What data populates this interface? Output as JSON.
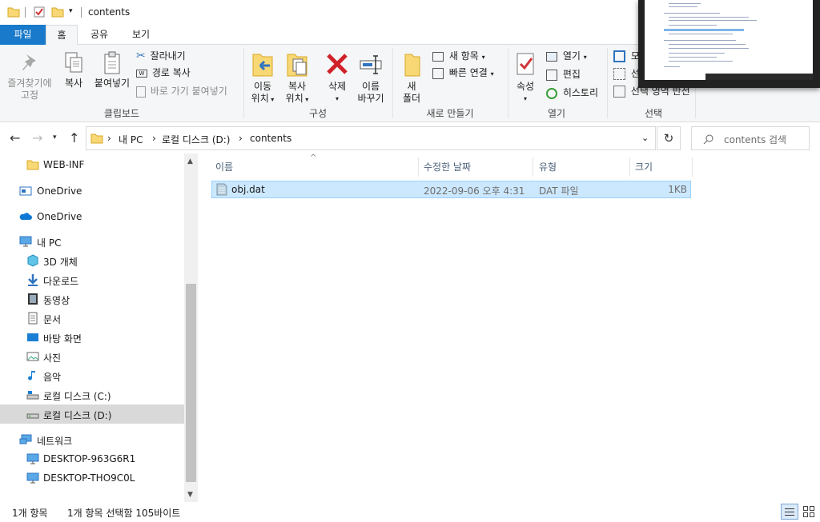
{
  "window": {
    "title": "contents"
  },
  "tabs": [
    {
      "label": "파일"
    },
    {
      "label": "홈"
    },
    {
      "label": "공유"
    },
    {
      "label": "보기"
    }
  ],
  "ribbon": {
    "clipboard": {
      "pin_line1": "즐겨찾기에",
      "pin_line2": "고정",
      "copy": "복사",
      "paste": "붙여넣기",
      "cut": "잘라내기",
      "copy_path": "경로 복사",
      "paste_shortcut": "바로 가기 붙여넣기",
      "group_label": "클립보드"
    },
    "organize": {
      "move_line1": "이동",
      "move_line2": "위치",
      "copyto_line1": "복사",
      "copyto_line2": "위치",
      "delete": "삭제",
      "rename_line1": "이름",
      "rename_line2": "바꾸기",
      "group_label": "구성"
    },
    "new": {
      "folder_line1": "새",
      "folder_line2": "폴더",
      "new_item": "새 항목",
      "easy_access": "빠른 연결",
      "group_label": "새로 만들기"
    },
    "open": {
      "properties": "속성",
      "open": "열기",
      "edit": "편집",
      "history": "히스토리",
      "group_label": "열기"
    },
    "select": {
      "select_all": "모",
      "select_none": "선",
      "invert": "선택 영역 반전",
      "group_label": "선택"
    }
  },
  "address": {
    "crumbs": [
      "내 PC",
      "로컬 디스크 (D:)",
      "contents"
    ],
    "search_placeholder": "contents 검색"
  },
  "nav": {
    "items": [
      {
        "label": "WEB-INF",
        "icon": "folder-icon"
      },
      {
        "label": "OneDrive",
        "icon": "onedrive-business-icon"
      },
      {
        "label": "OneDrive",
        "icon": "onedrive-cloud-icon"
      },
      {
        "label": "내 PC",
        "icon": "pc-icon"
      },
      {
        "label": "3D 개체",
        "icon": "3d-objects-icon"
      },
      {
        "label": "다운로드",
        "icon": "download-icon"
      },
      {
        "label": "동영상",
        "icon": "video-icon"
      },
      {
        "label": "문서",
        "icon": "document-icon"
      },
      {
        "label": "바탕 화면",
        "icon": "desktop-icon"
      },
      {
        "label": "사진",
        "icon": "pictures-icon"
      },
      {
        "label": "음악",
        "icon": "music-icon"
      },
      {
        "label": "로컬 디스크 (C:)",
        "icon": "drive-c-icon"
      },
      {
        "label": "로컬 디스크 (D:)",
        "icon": "drive-d-icon"
      },
      {
        "label": "네트워크",
        "icon": "network-icon"
      },
      {
        "label": "DESKTOP-963G6R1",
        "icon": "computer-icon"
      },
      {
        "label": "DESKTOP-THO9C0L",
        "icon": "computer-icon"
      }
    ]
  },
  "list": {
    "columns": [
      "이름",
      "수정한 날짜",
      "유형",
      "크기"
    ],
    "rows": [
      {
        "name": "obj.dat",
        "modified": "2022-09-06 오후 4:31",
        "type": "DAT 파일",
        "size": "1KB"
      }
    ]
  },
  "status": {
    "count": "1개 항목",
    "selected": "1개 항목 선택함 105바이트"
  },
  "colors": {
    "file_tab": "#1979ca",
    "selection": "#cce8ff",
    "selection_border": "#99d1ff",
    "nav_selected": "#d9d9d9",
    "ribbon_bg": "#f5f6f7"
  }
}
